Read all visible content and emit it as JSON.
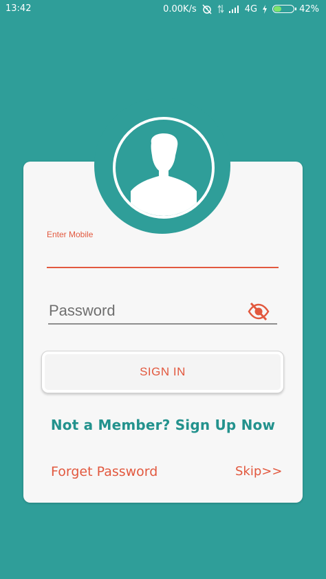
{
  "status_bar": {
    "time": "13:42",
    "network_speed": "0.00K/s",
    "network_type": "4G",
    "battery_percent": "42%",
    "battery_level": 0.42,
    "icons": [
      "alarm-off-icon",
      "data-arrows-icon",
      "signal-icon",
      "charging-icon",
      "battery-icon"
    ]
  },
  "colors": {
    "background": "#2f9e99",
    "accent": "#e2583e",
    "link_teal": "#23928d",
    "card": "#f7f7f7"
  },
  "login": {
    "avatar_icon": "user-silhouette-icon",
    "mobile_label": "Enter Mobile",
    "mobile_value": "",
    "password_placeholder": "Password",
    "password_value": "",
    "password_toggle_icon": "eye-off-icon",
    "signin_label": "SIGN IN",
    "signup_text": "Not a Member? Sign Up Now",
    "forget_password": "Forget Password",
    "skip": "Skip>>"
  }
}
